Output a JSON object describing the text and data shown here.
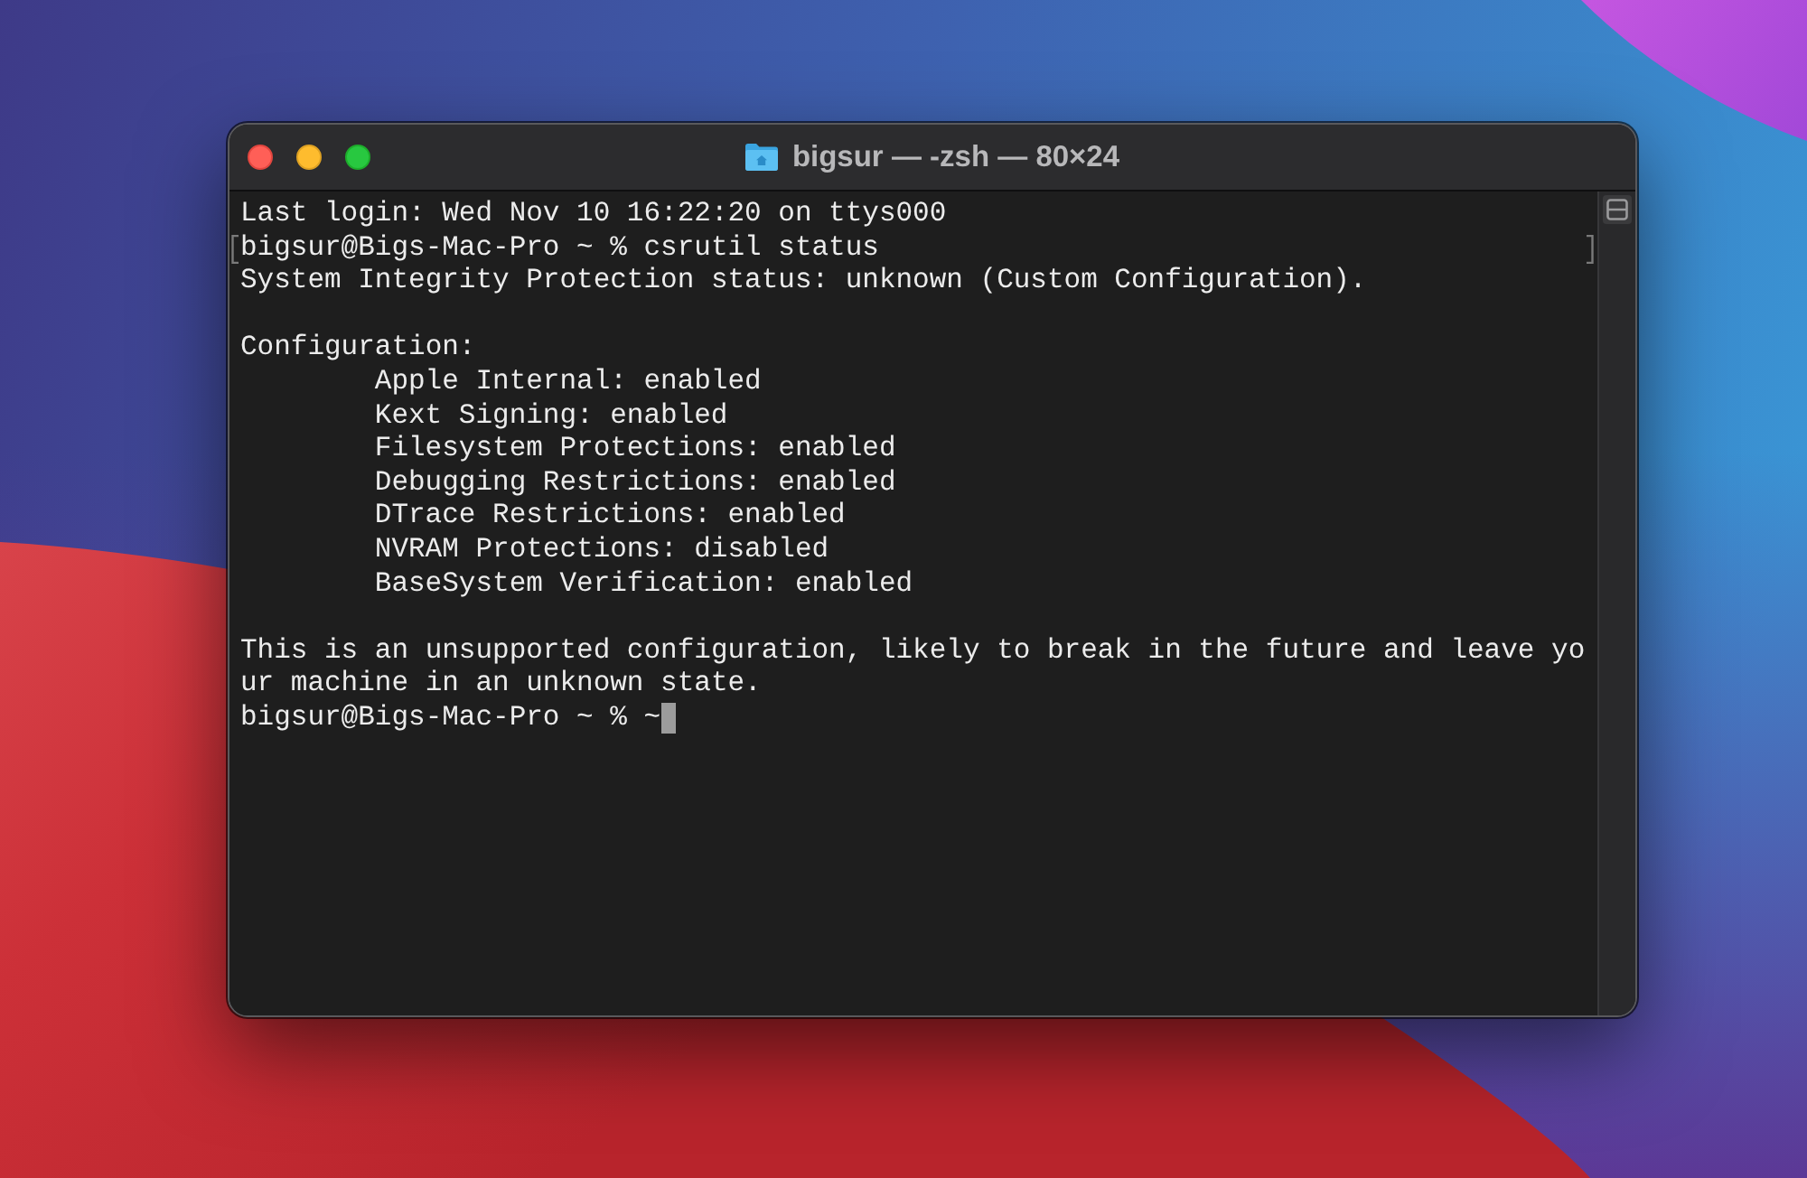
{
  "window": {
    "title": "bigsur — -zsh — 80×24",
    "buttons": [
      {
        "kind": "close"
      },
      {
        "kind": "minimize"
      },
      {
        "kind": "zoom"
      }
    ]
  },
  "terminal": {
    "blocks": [
      {
        "lines": [
          {
            "text": "Last login: Wed Nov 10 16:22:20 on ttys000",
            "marked": false,
            "cursor": false
          },
          {
            "text": "bigsur@Bigs-Mac-Pro ~ % csrutil status",
            "marked": true,
            "cursor": false
          },
          {
            "text": "System Integrity Protection status: unknown (Custom Configuration).",
            "marked": false,
            "cursor": false
          }
        ]
      },
      {
        "lines": [
          {
            "text": "Configuration:",
            "marked": false,
            "cursor": false,
            "children": [
              {
                "text": "Apple Internal: enabled",
                "marked": false,
                "cursor": false
              },
              {
                "text": "Kext Signing: enabled",
                "marked": false,
                "cursor": false
              },
              {
                "text": "Filesystem Protections: enabled",
                "marked": false,
                "cursor": false
              },
              {
                "text": "Debugging Restrictions: enabled",
                "marked": false,
                "cursor": false
              },
              {
                "text": "DTrace Restrictions: enabled",
                "marked": false,
                "cursor": false
              },
              {
                "text": "NVRAM Protections: disabled",
                "marked": false,
                "cursor": false
              },
              {
                "text": "BaseSystem Verification: enabled",
                "marked": false,
                "cursor": false
              }
            ]
          }
        ]
      },
      {
        "lines": [
          {
            "text": "This is an unsupported configuration, likely to break in the future and leave yo",
            "marked": false,
            "cursor": false
          },
          {
            "text": "ur machine in an unknown state.",
            "marked": false,
            "cursor": false
          },
          {
            "text": "bigsur@Bigs-Mac-Pro ~ % ~",
            "marked": false,
            "cursor": true
          }
        ]
      }
    ]
  }
}
